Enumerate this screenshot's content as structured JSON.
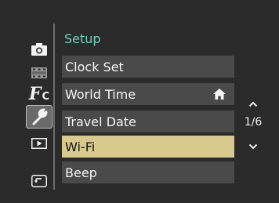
{
  "menu": {
    "title": "Setup",
    "items": [
      {
        "label": "Clock Set"
      },
      {
        "label": "World Time"
      },
      {
        "label": "Travel Date"
      },
      {
        "label": "Wi-Fi"
      },
      {
        "label": "Beep"
      }
    ],
    "selected_index": 3
  },
  "sidebar": {
    "icons": [
      "camera-icon",
      "movie-icon",
      "custom-function-icon",
      "wrench-setup-icon",
      "playback-icon",
      "back-icon"
    ],
    "custom_function_text": "F",
    "custom_function_sub": "C",
    "selected": "wrench-setup-icon"
  },
  "pager": {
    "page_text": "1/6"
  },
  "colors": {
    "title": "#6fd3c0",
    "item_bg": "#4a4a4a",
    "selected_bg": "#d8c98c",
    "background": "#2b2b2b"
  }
}
